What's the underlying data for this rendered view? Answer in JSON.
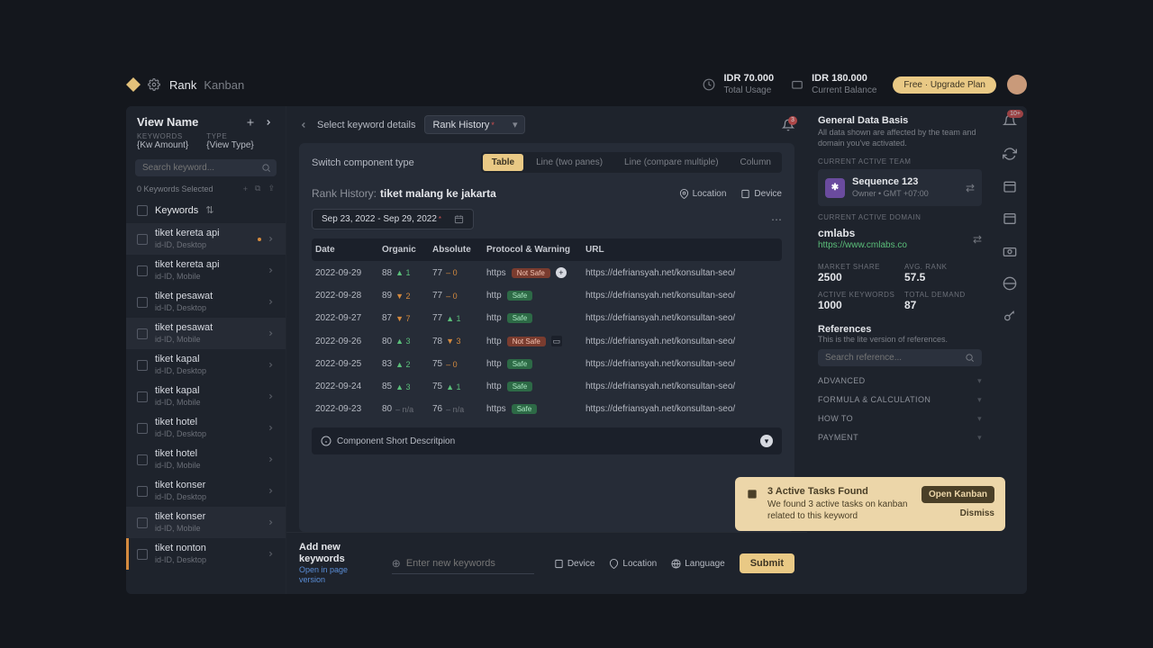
{
  "topbar": {
    "nav_rank": "Rank",
    "nav_kanban": "Kanban",
    "usage_value": "IDR 70.000",
    "usage_label": "Total Usage",
    "balance_value": "IDR 180.000",
    "balance_label": "Current Balance",
    "upgrade": "Free · Upgrade Plan"
  },
  "sidebar": {
    "view_name": "View Name",
    "kw_label": "KEYWORDS",
    "kw_value": "{Kw Amount}",
    "type_label": "TYPE",
    "type_value": "{View Type}",
    "search_ph": "Search keyword...",
    "selected": "0 Keywords Selected",
    "header": "Keywords",
    "items": [
      {
        "name": "tiket kereta api",
        "meta": "id-ID, Desktop",
        "highlight": true,
        "dot": true
      },
      {
        "name": "tiket kereta api",
        "meta": "id-ID, Mobile"
      },
      {
        "name": "tiket pesawat",
        "meta": "id-ID, Desktop"
      },
      {
        "name": "tiket pesawat",
        "meta": "id-ID, Mobile",
        "highlight": true
      },
      {
        "name": "tiket kapal",
        "meta": "id-ID, Desktop"
      },
      {
        "name": "tiket kapal",
        "meta": "id-ID, Mobile"
      },
      {
        "name": "tiket hotel",
        "meta": "id-ID, Desktop"
      },
      {
        "name": "tiket hotel",
        "meta": "id-ID, Mobile"
      },
      {
        "name": "tiket konser",
        "meta": "id-ID, Desktop"
      },
      {
        "name": "tiket konser",
        "meta": "id-ID, Mobile",
        "highlight": true
      },
      {
        "name": "tiket nonton",
        "meta": "id-ID, Desktop",
        "tag": true
      }
    ]
  },
  "center": {
    "crumb_select": "Select keyword details",
    "crumb_dd": "Rank History",
    "bell_count": "3",
    "switch_label": "Switch component type",
    "chips": [
      "Table",
      "Line (two panes)",
      "Line (compare multiple)",
      "Column"
    ],
    "title_label": "Rank History:",
    "title_value": "tiket malang ke jakarta",
    "loc": "Location",
    "dev": "Device",
    "date_range": "Sep 23, 2022 - Sep 29, 2022",
    "cols": {
      "date": "Date",
      "organic": "Organic",
      "absolute": "Absolute",
      "proto": "Protocol & Warning",
      "url": "URL"
    },
    "rows": [
      {
        "date": "2022-09-29",
        "org": "88",
        "org_d": "▲ 1",
        "org_c": "up",
        "abs": "77",
        "abs_d": "– 0",
        "abs_c": "neutral",
        "proto": "https",
        "badge": "Not Safe",
        "badge_t": "notsafe",
        "picon": "plus",
        "url": "https://defriansyah.net/konsultan-seo/"
      },
      {
        "date": "2022-09-28",
        "org": "89",
        "org_d": "▼ 2",
        "org_c": "down",
        "abs": "77",
        "abs_d": "– 0",
        "abs_c": "neutral",
        "proto": "http",
        "badge": "Safe",
        "badge_t": "safe",
        "url": "https://defriansyah.net/konsultan-seo/"
      },
      {
        "date": "2022-09-27",
        "org": "87",
        "org_d": "▼ 7",
        "org_c": "down",
        "abs": "77",
        "abs_d": "▲ 1",
        "abs_c": "up",
        "proto": "http",
        "badge": "Safe",
        "badge_t": "safe",
        "url": "https://defriansyah.net/konsultan-seo/"
      },
      {
        "date": "2022-09-26",
        "org": "80",
        "org_d": "▲ 3",
        "org_c": "up",
        "abs": "78",
        "abs_d": "▼ 3",
        "abs_c": "down",
        "proto": "http",
        "badge": "Not Safe",
        "badge_t": "notsafe",
        "picon": "dark",
        "url": "https://defriansyah.net/konsultan-seo/"
      },
      {
        "date": "2022-09-25",
        "org": "83",
        "org_d": "▲ 2",
        "org_c": "up",
        "abs": "75",
        "abs_d": "– 0",
        "abs_c": "neutral",
        "proto": "http",
        "badge": "Safe",
        "badge_t": "safe",
        "url": "https://defriansyah.net/konsultan-seo/"
      },
      {
        "date": "2022-09-24",
        "org": "85",
        "org_d": "▲ 3",
        "org_c": "up",
        "abs": "75",
        "abs_d": "▲ 1",
        "abs_c": "up",
        "proto": "http",
        "badge": "Safe",
        "badge_t": "safe",
        "url": "https://defriansyah.net/konsultan-seo/"
      },
      {
        "date": "2022-09-23",
        "org": "80",
        "org_d": "– n/a",
        "org_c": "na",
        "abs": "76",
        "abs_d": "– n/a",
        "abs_c": "na",
        "proto": "https",
        "badge": "Safe",
        "badge_t": "safe",
        "url": "https://defriansyah.net/konsultan-seo/"
      }
    ],
    "desc": "Component Short Descritpion"
  },
  "bottom": {
    "title": "Add new keywords",
    "sub": "Open in page version",
    "input_ph": "Enter new keywords",
    "device": "Device",
    "location": "Location",
    "language": "Language",
    "submit": "Submit"
  },
  "right": {
    "title": "General Data Basis",
    "sub": "All data shown are affected by the team and domain you've activated.",
    "team_label": "CURRENT ACTIVE TEAM",
    "team_name": "Sequence 123",
    "team_meta": "Owner • GMT +07:00",
    "domain_label": "CURRENT ACTIVE DOMAIN",
    "domain_name": "cmlabs",
    "domain_url": "https://www.cmlabs.co",
    "stats": [
      {
        "l": "MARKET SHARE",
        "v": "2500"
      },
      {
        "l": "AVG. RANK",
        "v": "57.5"
      },
      {
        "l": "ACTIVE KEYWORDS",
        "v": "1000"
      },
      {
        "l": "TOTAL DEMAND",
        "v": "87"
      }
    ],
    "ref_title": "References",
    "ref_sub": "This is the lite version of references.",
    "ref_search_ph": "Search reference...",
    "ref_items": [
      "ADVANCED",
      "FORMULA & CALCULATION",
      "HOW TO",
      "PAYMENT"
    ],
    "bell_count": "10+"
  },
  "toast": {
    "title": "3 Active Tasks Found",
    "desc": "We found 3 active tasks on kanban related to this keyword",
    "open": "Open Kanban",
    "dismiss": "Dismiss"
  }
}
